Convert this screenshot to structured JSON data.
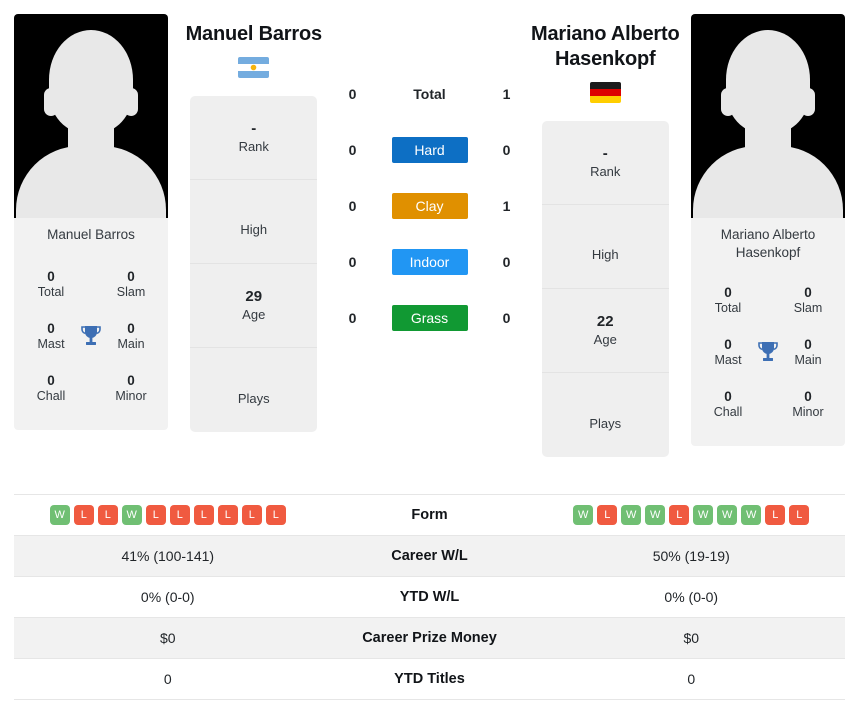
{
  "players": {
    "left": {
      "name": "Manuel Barros",
      "photo_caption": "Manuel Barros",
      "flag": "argentina-flag",
      "rank": "-",
      "rank_label": "Rank",
      "high": "",
      "high_label": "High",
      "age": "29",
      "age_label": "Age",
      "plays": "",
      "plays_label": "Plays",
      "titles": {
        "total": "0",
        "total_label": "Total",
        "slam": "0",
        "slam_label": "Slam",
        "mast": "0",
        "mast_label": "Mast",
        "main": "0",
        "main_label": "Main",
        "chall": "0",
        "chall_label": "Chall",
        "minor": "0",
        "minor_label": "Minor"
      },
      "form": [
        "W",
        "L",
        "L",
        "W",
        "L",
        "L",
        "L",
        "L",
        "L",
        "L"
      ],
      "career_wl": "41% (100-141)",
      "ytd_wl": "0% (0-0)",
      "career_prize_money": "$0",
      "ytd_titles": "0"
    },
    "right": {
      "name": "Mariano Alberto Hasenkopf",
      "photo_caption": "Mariano Alberto Hasenkopf",
      "flag": "germany-flag",
      "rank": "-",
      "rank_label": "Rank",
      "high": "",
      "high_label": "High",
      "age": "22",
      "age_label": "Age",
      "plays": "",
      "plays_label": "Plays",
      "titles": {
        "total": "0",
        "total_label": "Total",
        "slam": "0",
        "slam_label": "Slam",
        "mast": "0",
        "mast_label": "Mast",
        "main": "0",
        "main_label": "Main",
        "chall": "0",
        "chall_label": "Chall",
        "minor": "0",
        "minor_label": "Minor"
      },
      "form": [
        "W",
        "L",
        "W",
        "W",
        "L",
        "W",
        "W",
        "W",
        "L",
        "L"
      ],
      "career_wl": "50% (19-19)",
      "ytd_wl": "0% (0-0)",
      "career_prize_money": "$0",
      "ytd_titles": "0"
    }
  },
  "head_to_head": {
    "rows": [
      {
        "left": "0",
        "label": "Total",
        "right": "1",
        "badge": false,
        "color": ""
      },
      {
        "left": "0",
        "label": "Hard",
        "right": "0",
        "badge": true,
        "color": "#0d6fc4"
      },
      {
        "left": "0",
        "label": "Clay",
        "right": "1",
        "badge": true,
        "color": "#e09000"
      },
      {
        "left": "0",
        "label": "Indoor",
        "right": "0",
        "badge": true,
        "color": "#2196f3"
      },
      {
        "left": "0",
        "label": "Grass",
        "right": "0",
        "badge": true,
        "color": "#119933"
      }
    ]
  },
  "stats_table": {
    "rows": [
      {
        "label": "Form",
        "key": "form",
        "shaded": false
      },
      {
        "label": "Career W/L",
        "key": "career_wl",
        "shaded": true
      },
      {
        "label": "YTD W/L",
        "key": "ytd_wl",
        "shaded": false
      },
      {
        "label": "Career Prize Money",
        "key": "career_prize_money",
        "shaded": true
      },
      {
        "label": "YTD Titles",
        "key": "ytd_titles",
        "shaded": false
      }
    ]
  },
  "colors": {
    "win": "#70bf73",
    "loss": "#f05a40",
    "trophy": "#3d6fb4",
    "card_bg": "#efefef"
  }
}
